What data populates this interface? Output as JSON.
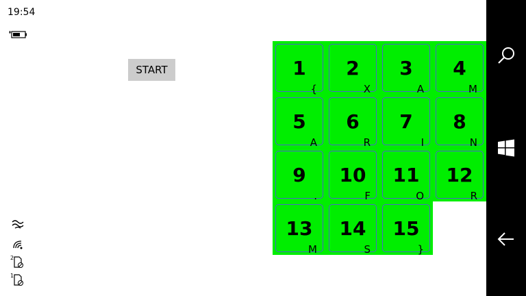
{
  "status": {
    "time": "19:54"
  },
  "start_button": {
    "label": "START"
  },
  "tiles": [
    {
      "number": "1",
      "letter": "{"
    },
    {
      "number": "2",
      "letter": "X"
    },
    {
      "number": "3",
      "letter": "A"
    },
    {
      "number": "4",
      "letter": "M"
    },
    {
      "number": "5",
      "letter": "A"
    },
    {
      "number": "6",
      "letter": "R"
    },
    {
      "number": "7",
      "letter": "I"
    },
    {
      "number": "8",
      "letter": "N"
    },
    {
      "number": "9",
      "letter": "."
    },
    {
      "number": "10",
      "letter": "F"
    },
    {
      "number": "11",
      "letter": "O"
    },
    {
      "number": "12",
      "letter": "R"
    },
    {
      "number": "13",
      "letter": "M"
    },
    {
      "number": "14",
      "letter": "S"
    },
    {
      "number": "15",
      "letter": "}"
    }
  ],
  "colors": {
    "tile": "#00ee00",
    "tile_border": "#4a68c8",
    "start_button": "#cccccc",
    "nav_bar": "#000000"
  },
  "icons": {
    "status": [
      "battery-icon"
    ],
    "left_panel": [
      "wifi-calling-icon",
      "signal-icon",
      "sim-2-icon",
      "sim-1-icon"
    ],
    "nav_bar": [
      "search-icon",
      "windows-icon",
      "back-icon"
    ]
  }
}
